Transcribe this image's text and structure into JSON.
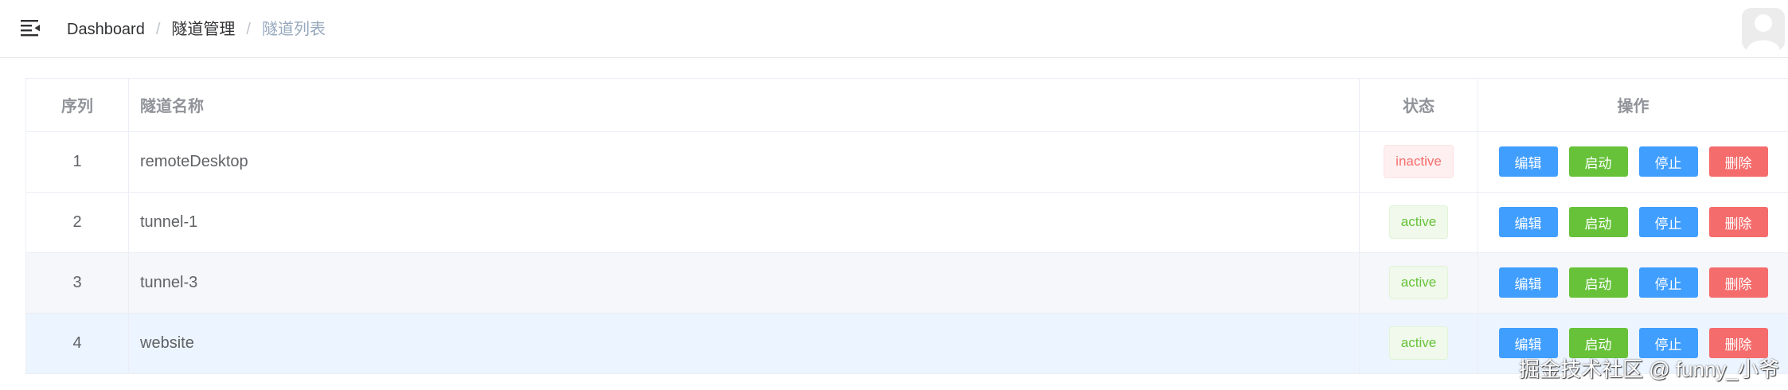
{
  "breadcrumb": {
    "root": "Dashboard",
    "separator": "/",
    "section": "隧道管理",
    "current": "隧道列表"
  },
  "table": {
    "headers": {
      "index": "序列",
      "name": "隧道名称",
      "status": "状态",
      "actions": "操作"
    },
    "rows": [
      {
        "index": "1",
        "name": "remoteDesktop",
        "status": "inactive"
      },
      {
        "index": "2",
        "name": "tunnel-1",
        "status": "active"
      },
      {
        "index": "3",
        "name": "tunnel-3",
        "status": "active"
      },
      {
        "index": "4",
        "name": "website",
        "status": "active"
      }
    ],
    "action_labels": {
      "edit": "编辑",
      "start": "启动",
      "stop": "停止",
      "delete": "删除"
    }
  },
  "watermark": "掘金技术社区 @ funny_小爷",
  "colors": {
    "primary": "#409eff",
    "success": "#67c23a",
    "danger": "#f56c6c",
    "muted_text": "#97a8be",
    "header_text": "#909399"
  }
}
